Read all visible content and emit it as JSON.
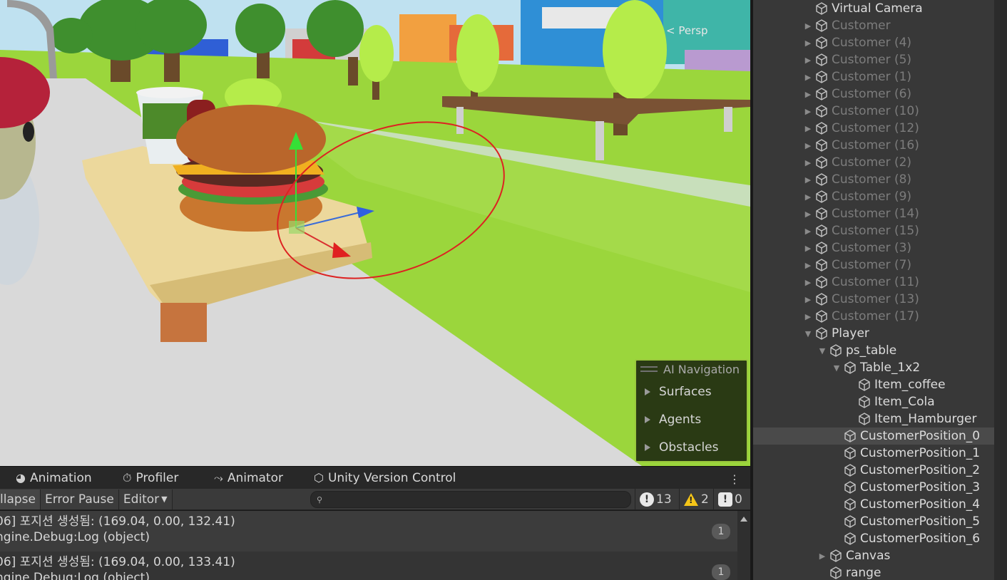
{
  "scene": {
    "perspective_label": "< Persp",
    "ai_navigation": {
      "title": "AI Navigation",
      "items": [
        "Surfaces",
        "Agents",
        "Obstacles"
      ]
    }
  },
  "console": {
    "tabs": [
      {
        "icon": "animation-icon",
        "glyph": "◕",
        "label": "Animation"
      },
      {
        "icon": "profiler-icon",
        "glyph": "⏱",
        "label": "Profiler"
      },
      {
        "icon": "animator-icon",
        "glyph": "⤳",
        "label": "Animator"
      },
      {
        "icon": "unity-version-control-icon",
        "glyph": "⬡",
        "label": "Unity Version Control"
      }
    ],
    "toolbar": {
      "collapse": "llapse",
      "error_pause": "Error Pause",
      "editor": "Editor",
      "search_placeholder": ""
    },
    "counts": {
      "log": "13",
      "warning": "2",
      "error": "0"
    },
    "entries": [
      {
        "line1": "06] 포지션 생성됨: (169.04, 0.00, 132.41)",
        "line2": "ngine.Debug:Log (object)",
        "count": "1"
      },
      {
        "line1": "06] 포지션 생성됨: (169.04, 0.00, 133.41)",
        "line2": "ngine.Debug:Log (object)",
        "count": "1"
      }
    ]
  },
  "hierarchy": {
    "items": [
      {
        "label": "Virtual Camera",
        "depth": 0,
        "arrow": "",
        "style": "bright"
      },
      {
        "label": "Customer",
        "depth": 0,
        "arrow": "right",
        "style": "dim"
      },
      {
        "label": "Customer (4)",
        "depth": 0,
        "arrow": "right",
        "style": "dim"
      },
      {
        "label": "Customer (5)",
        "depth": 0,
        "arrow": "right",
        "style": "dim"
      },
      {
        "label": "Customer (1)",
        "depth": 0,
        "arrow": "right",
        "style": "dim"
      },
      {
        "label": "Customer (6)",
        "depth": 0,
        "arrow": "right",
        "style": "dim"
      },
      {
        "label": "Customer (10)",
        "depth": 0,
        "arrow": "right",
        "style": "dim"
      },
      {
        "label": "Customer (12)",
        "depth": 0,
        "arrow": "right",
        "style": "dim"
      },
      {
        "label": "Customer (16)",
        "depth": 0,
        "arrow": "right",
        "style": "dim"
      },
      {
        "label": "Customer (2)",
        "depth": 0,
        "arrow": "right",
        "style": "dim"
      },
      {
        "label": "Customer (8)",
        "depth": 0,
        "arrow": "right",
        "style": "dim"
      },
      {
        "label": "Customer (9)",
        "depth": 0,
        "arrow": "right",
        "style": "dim"
      },
      {
        "label": "Customer (14)",
        "depth": 0,
        "arrow": "right",
        "style": "dim"
      },
      {
        "label": "Customer (15)",
        "depth": 0,
        "arrow": "right",
        "style": "dim"
      },
      {
        "label": "Customer (3)",
        "depth": 0,
        "arrow": "right",
        "style": "dim"
      },
      {
        "label": "Customer (7)",
        "depth": 0,
        "arrow": "right",
        "style": "dim"
      },
      {
        "label": "Customer (11)",
        "depth": 0,
        "arrow": "right",
        "style": "dim"
      },
      {
        "label": "Customer (13)",
        "depth": 0,
        "arrow": "right",
        "style": "dim"
      },
      {
        "label": "Customer (17)",
        "depth": 0,
        "arrow": "right",
        "style": "dim"
      },
      {
        "label": "Player",
        "depth": 0,
        "arrow": "down",
        "style": "bright"
      },
      {
        "label": "ps_table",
        "depth": 1,
        "arrow": "down",
        "style": "bright"
      },
      {
        "label": "Table_1x2",
        "depth": 2,
        "arrow": "down",
        "style": "bright"
      },
      {
        "label": "Item_coffee",
        "depth": 3,
        "arrow": "",
        "style": "bright"
      },
      {
        "label": "Item_Cola",
        "depth": 3,
        "arrow": "",
        "style": "bright"
      },
      {
        "label": "Item_Hamburger",
        "depth": 3,
        "arrow": "",
        "style": "bright"
      },
      {
        "label": "CustomerPosition_0",
        "depth": 2,
        "arrow": "",
        "style": "bright",
        "selected": true
      },
      {
        "label": "CustomerPosition_1",
        "depth": 2,
        "arrow": "",
        "style": "bright"
      },
      {
        "label": "CustomerPosition_2",
        "depth": 2,
        "arrow": "",
        "style": "bright"
      },
      {
        "label": "CustomerPosition_3",
        "depth": 2,
        "arrow": "",
        "style": "bright"
      },
      {
        "label": "CustomerPosition_4",
        "depth": 2,
        "arrow": "",
        "style": "bright"
      },
      {
        "label": "CustomerPosition_5",
        "depth": 2,
        "arrow": "",
        "style": "bright"
      },
      {
        "label": "CustomerPosition_6",
        "depth": 2,
        "arrow": "",
        "style": "bright"
      },
      {
        "label": "Canvas",
        "depth": 1,
        "arrow": "right",
        "style": "bright"
      },
      {
        "label": "range",
        "depth": 1,
        "arrow": "",
        "style": "bright"
      }
    ]
  }
}
